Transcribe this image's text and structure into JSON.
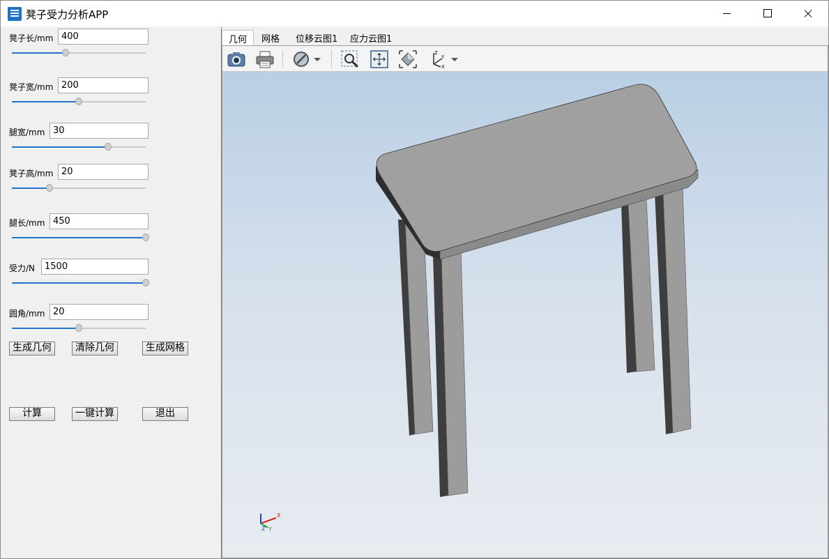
{
  "window": {
    "title": "凳子受力分析APP"
  },
  "params": [
    {
      "label": "凳子长/mm",
      "value": "400",
      "fraction": 0.4
    },
    {
      "label": "凳子宽/mm",
      "value": "200",
      "fraction": 0.5
    },
    {
      "label": "腿宽/mm",
      "value": "30",
      "fraction": 0.72
    },
    {
      "label": "凳子高/mm",
      "value": "20",
      "fraction": 0.28
    },
    {
      "label": "腿长/mm",
      "value": "450",
      "fraction": 1.0
    },
    {
      "label": "受力/N",
      "value": "1500",
      "fraction": 1.0
    },
    {
      "label": "圆角/mm",
      "value": "20",
      "fraction": 0.5
    }
  ],
  "buttons": {
    "generate_geometry": "生成几何",
    "clear_geometry": "清除几何",
    "generate_mesh": "生成网格",
    "calculate": "计算",
    "one_click_calculate": "一键计算",
    "exit": "退出"
  },
  "tabs": [
    "几何",
    "网格",
    "位移云图1",
    "应力云图1"
  ],
  "active_tab": "几何",
  "toolbar": {
    "icons": [
      "camera-icon",
      "print-icon",
      "no-entry-icon",
      "dropdown-arrow-icon",
      "zoom-window-icon",
      "fit-all-icon",
      "view-iso-icon",
      "axes-icon",
      "dropdown-arrow-icon"
    ]
  },
  "triad": {
    "x": "X",
    "y": "Y",
    "z": "Z"
  },
  "colors": {
    "accent": "#1e73c8",
    "model_face": "#a0a0a0",
    "model_side": "#4a4a4a"
  }
}
